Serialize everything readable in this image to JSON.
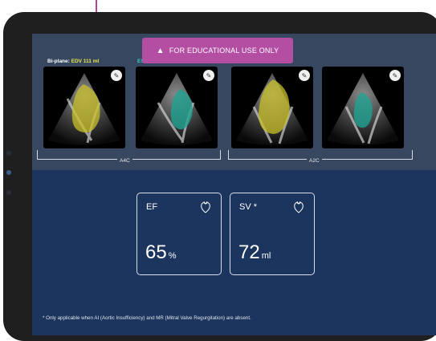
{
  "banner": {
    "text": "FOR EDUCATIONAL USE ONLY",
    "icon": "warning-icon"
  },
  "labels": {
    "biplane": "Bi-plane:",
    "edv": "EDV 111 ml",
    "esv": "ESV 39 ml"
  },
  "views": [
    {
      "name": "A4C",
      "tiles": [
        "edv",
        "esv"
      ]
    },
    {
      "name": "A2C",
      "tiles": [
        "edv",
        "esv"
      ]
    }
  ],
  "metrics": {
    "ef": {
      "title": "EF",
      "value": "65",
      "unit": "%"
    },
    "sv": {
      "title": "SV *",
      "value": "72",
      "unit": "ml"
    }
  },
  "footnote": "* Only applicable when AI (Aortic Insufficiency) and MR (Mitral Valve Regurgitation) are absent.",
  "colors": {
    "banner": "#b34ea3",
    "edv_overlay": "#c8c22a",
    "esv_overlay": "#1fa391",
    "screen_bg": "#1b355e",
    "panel_bg": "#374760"
  }
}
